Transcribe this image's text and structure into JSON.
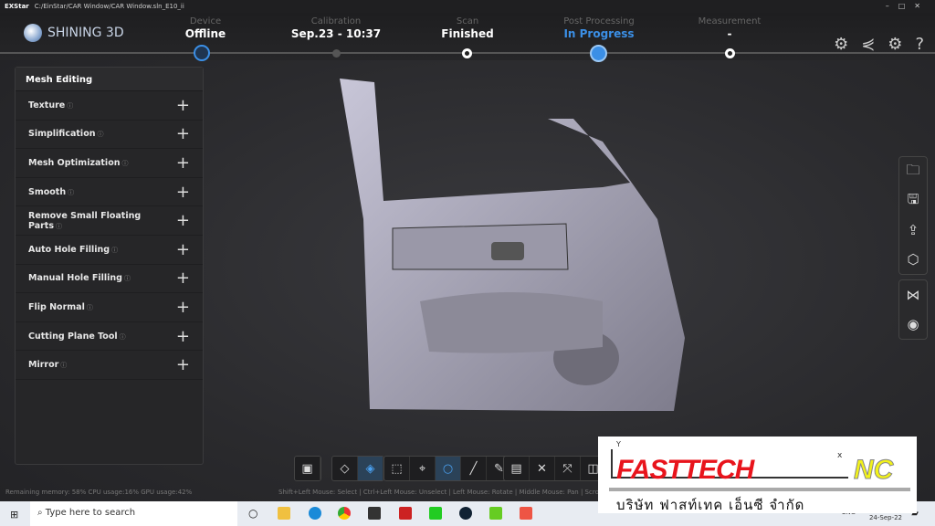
{
  "titlebar": {
    "app": "EXStar",
    "path": "C:/EinStar/CAR Window/CAR Window.sln_E10_ii"
  },
  "logo": {
    "text": "SHINING 3D"
  },
  "steps": [
    {
      "label": "Device",
      "value": "Offline"
    },
    {
      "label": "Calibration",
      "value": "Sep.23 - 10:37"
    },
    {
      "label": "Scan",
      "value": "Finished"
    },
    {
      "label": "Post Processing",
      "value": "In Progress"
    },
    {
      "label": "Measurement",
      "value": "-"
    }
  ],
  "header_icons": [
    "new-feature-icon",
    "share-icon",
    "settings-icon",
    "help-icon"
  ],
  "panel": {
    "title": "Mesh Editing",
    "items": [
      {
        "label": "Texture"
      },
      {
        "label": "Simplification"
      },
      {
        "label": "Mesh Optimization"
      },
      {
        "label": "Smooth"
      },
      {
        "label": "Remove Small Floating Parts"
      },
      {
        "label": "Auto Hole Filling"
      },
      {
        "label": "Manual Hole Filling"
      },
      {
        "label": "Flip Normal"
      },
      {
        "label": "Cutting Plane Tool"
      },
      {
        "label": "Mirror"
      }
    ]
  },
  "status": "Remaining memory: 58% CPU usage:16% GPU usage:42%",
  "hint": "Shift+Left Mouse: Select | Ctrl+Left Mouse: Unselect | Left Mouse: Rotate | Middle Mouse: Pan | Scroll",
  "taskbar": {
    "search_placeholder": "Type here to search",
    "lang": "ENG",
    "date": "24-Sep-22"
  },
  "watermark": {
    "brand": "FASTTECH",
    "suffix": "NC",
    "thai": "บริษัท ฟาสท์เทค เอ็นซี จำกัด",
    "axis_y": "Y",
    "axis_x": "x"
  },
  "colors": {
    "accent": "#3b8fe6",
    "brand_red": "#e8141c",
    "brand_blue": "#1a2fd8",
    "brand_yellow": "#f2f21a"
  }
}
